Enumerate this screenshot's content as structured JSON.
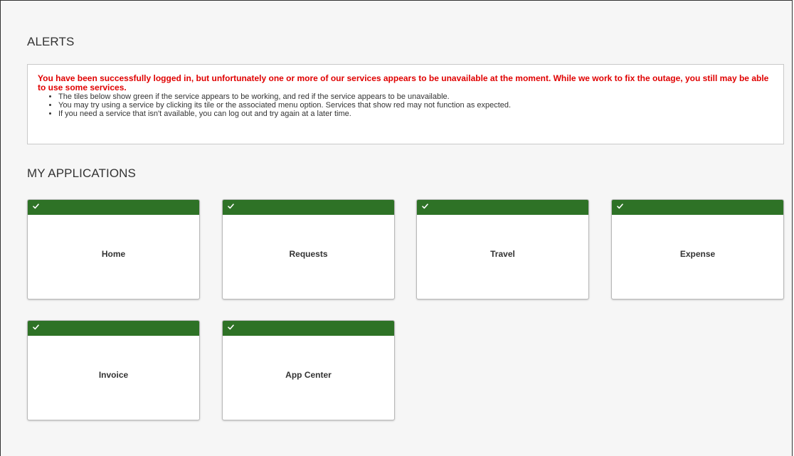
{
  "alerts": {
    "title": "ALERTS",
    "headline": "You have been successfully logged in, but unfortunately one or more of our services appears to be unavailable at the moment. While we work to fix the outage, you still may be able to use some services.",
    "items": [
      "The tiles below show green if the service appears to be working, and red if the service appears to be unavailable.",
      "You may try using a service by clicking its tile or the associated menu option. Services that show red may not function as expected.",
      "If you need a service that isn't available, you can log out and try again at a later time."
    ]
  },
  "applications": {
    "title": "MY APPLICATIONS",
    "tiles": [
      {
        "label": "Home",
        "status": "working",
        "status_icon": "checkmark-icon"
      },
      {
        "label": "Requests",
        "status": "working",
        "status_icon": "checkmark-icon"
      },
      {
        "label": "Travel",
        "status": "working",
        "status_icon": "checkmark-icon"
      },
      {
        "label": "Expense",
        "status": "working",
        "status_icon": "checkmark-icon"
      },
      {
        "label": "Invoice",
        "status": "working",
        "status_icon": "checkmark-icon"
      },
      {
        "label": "App Center",
        "status": "working",
        "status_icon": "checkmark-icon"
      }
    ]
  },
  "colors": {
    "status_working": "#2e7226",
    "alert_text": "#e00000",
    "page_background": "#f6f6f6"
  }
}
